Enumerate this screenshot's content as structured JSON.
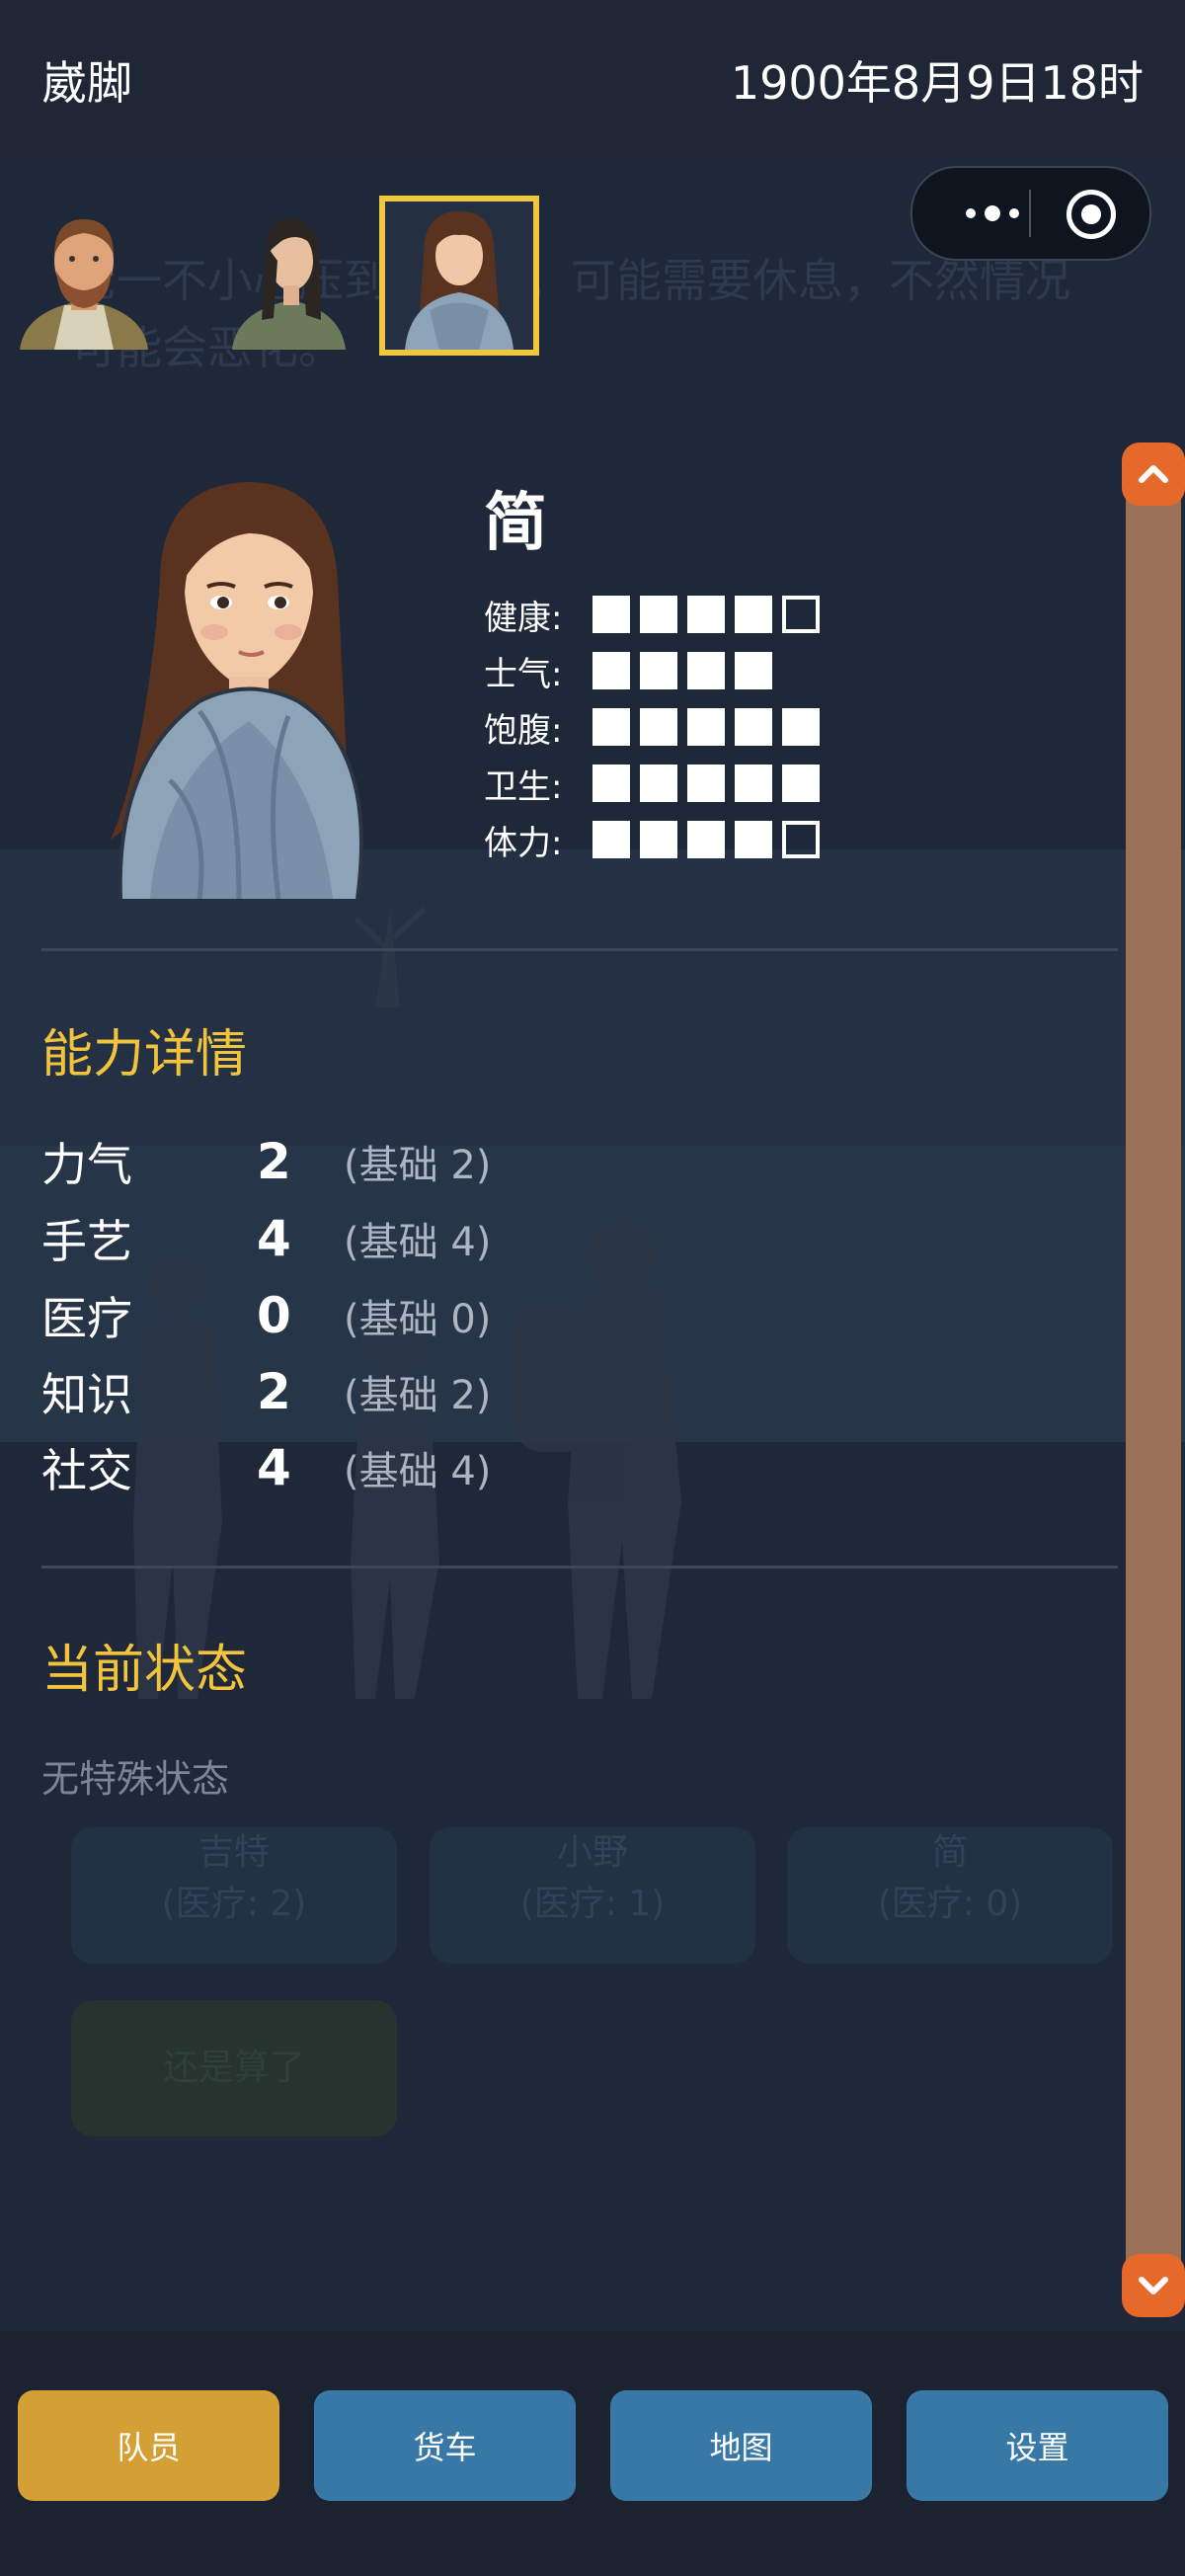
{
  "header": {
    "location": "崴脚",
    "datetime": "1900年8月9日18时"
  },
  "event_text": "轮一不小心压到的脚了，可能需要休息，不然情况可能会恶化。",
  "party": [
    {
      "name": "吉特",
      "selected": false
    },
    {
      "name": "小野",
      "selected": false
    },
    {
      "name": "简",
      "selected": true
    }
  ],
  "character": {
    "name": "简",
    "stats": [
      {
        "label": "健康:",
        "value": 4,
        "max": 5
      },
      {
        "label": "士气:",
        "value": 4,
        "max": 4
      },
      {
        "label": "饱腹:",
        "value": 5,
        "max": 5
      },
      {
        "label": "卫生:",
        "value": 5,
        "max": 5
      },
      {
        "label": "体力:",
        "value": 4,
        "max": 5
      }
    ]
  },
  "abilities": {
    "title": "能力详情",
    "rows": [
      {
        "name": "力气",
        "value": "2",
        "base": "(基础 2)"
      },
      {
        "name": "手艺",
        "value": "4",
        "base": "(基础 4)"
      },
      {
        "name": "医疗",
        "value": "0",
        "base": "(基础 0)"
      },
      {
        "name": "知识",
        "value": "2",
        "base": "(基础 2)"
      },
      {
        "name": "社交",
        "value": "4",
        "base": "(基础 4)"
      }
    ]
  },
  "status": {
    "title": "当前状态",
    "text": "无特殊状态"
  },
  "background_buttons": [
    {
      "name": "吉特",
      "detail": "(医疗: 2)"
    },
    {
      "name": "小野",
      "detail": "(医疗: 1)"
    },
    {
      "name": "简",
      "detail": "(医疗: 0)"
    }
  ],
  "background_cancel": "还是算了",
  "nav": [
    {
      "label": "队员",
      "color": "#d4a035",
      "active": true
    },
    {
      "label": "货车",
      "color": "#3878a6",
      "active": false
    },
    {
      "label": "地图",
      "color": "#3878a6",
      "active": false
    },
    {
      "label": "设置",
      "color": "#3878a6",
      "active": false
    }
  ],
  "colors": {
    "accent": "#f2c43c",
    "scroll": "#9a7258",
    "scroll_button": "#e6682a"
  }
}
